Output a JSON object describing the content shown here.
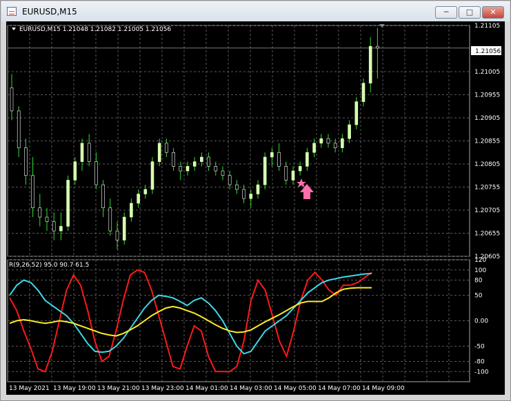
{
  "window": {
    "title": "EURUSD,M15",
    "buttons": {
      "minimize": "─",
      "maximize": "□",
      "close": "✕"
    }
  },
  "chart": {
    "header": "EURUSD,M15  1.21048 1.21082 1.21005 1.21056",
    "current_price_label": "1.21056",
    "current_price": 1.21056,
    "indicator_header": "R(9,26,52) 95.0 90.7 61.5",
    "colors": {
      "background": "#000000",
      "grid": "#5a5a5a",
      "bull_candle": "#d8ffb0",
      "bear_candle": "#000000",
      "wick": "#33dd33",
      "red_line": "#ff1a1a",
      "cyan_line": "#3fd8ec",
      "yellow_line": "#ffee22",
      "arrow": "#ff6fa8"
    },
    "signal_icons": [
      "star-icon",
      "up-arrow-icon"
    ]
  },
  "chart_data": [
    {
      "type": "candlestick",
      "title": "EURUSD,M15",
      "ylim": [
        1.20605,
        1.21105
      ],
      "y_ticks": [
        "1.21105",
        "1.21056",
        "1.21005",
        "1.20955",
        "1.20905",
        "1.20855",
        "1.20805",
        "1.20755",
        "1.20705",
        "1.20655",
        "1.20605"
      ],
      "x_ticks": [
        "13 May 2021",
        "13 May 19:00",
        "13 May 21:00",
        "13 May 23:00",
        "14 May 01:00",
        "14 May 03:00",
        "14 May 05:00",
        "14 May 07:00",
        "14 May 09:00"
      ],
      "candles": [
        [
          1.2097,
          1.21,
          1.209,
          1.2092
        ],
        [
          1.2092,
          1.2093,
          1.2082,
          1.2084
        ],
        [
          1.2084,
          1.2086,
          1.2076,
          1.2078
        ],
        [
          1.2078,
          1.2082,
          1.2069,
          1.2071
        ],
        [
          1.2071,
          1.2074,
          1.2067,
          1.2069
        ],
        [
          1.2069,
          1.2071,
          1.2066,
          1.2068
        ],
        [
          1.2068,
          1.207,
          1.2064,
          1.2066
        ],
        [
          1.2066,
          1.207,
          1.2064,
          1.2067
        ],
        [
          1.2067,
          1.2078,
          1.2066,
          1.2077
        ],
        [
          1.2077,
          1.2082,
          1.2076,
          1.2081
        ],
        [
          1.2081,
          1.2086,
          1.2079,
          1.2085
        ],
        [
          1.2085,
          1.2087,
          1.208,
          1.2081
        ],
        [
          1.2081,
          1.2083,
          1.2075,
          1.2076
        ],
        [
          1.2076,
          1.2077,
          1.2069,
          1.2071
        ],
        [
          1.2071,
          1.2073,
          1.2065,
          1.2066
        ],
        [
          1.2066,
          1.2068,
          1.2062,
          1.2064
        ],
        [
          1.2064,
          1.207,
          1.2063,
          1.2069
        ],
        [
          1.2069,
          1.2073,
          1.2068,
          1.2072
        ],
        [
          1.2072,
          1.2075,
          1.2071,
          1.2074
        ],
        [
          1.2074,
          1.2076,
          1.2073,
          1.2075
        ],
        [
          1.2075,
          1.2082,
          1.2074,
          1.2081
        ],
        [
          1.2081,
          1.2086,
          1.208,
          1.2085
        ],
        [
          1.2085,
          1.2086,
          1.2082,
          1.2083
        ],
        [
          1.2083,
          1.2084,
          1.2079,
          1.208
        ],
        [
          1.208,
          1.2081,
          1.2077,
          1.2079
        ],
        [
          1.2079,
          1.2081,
          1.2078,
          1.208
        ],
        [
          1.208,
          1.2082,
          1.2079,
          1.2081
        ],
        [
          1.2081,
          1.2083,
          1.208,
          1.2082
        ],
        [
          1.2082,
          1.2083,
          1.2079,
          1.208
        ],
        [
          1.208,
          1.2081,
          1.2078,
          1.2079
        ],
        [
          1.2079,
          1.208,
          1.2077,
          1.2078
        ],
        [
          1.2078,
          1.2079,
          1.2075,
          1.2076
        ],
        [
          1.2076,
          1.2077,
          1.2074,
          1.2075
        ],
        [
          1.2075,
          1.2076,
          1.2072,
          1.2073
        ],
        [
          1.2073,
          1.2075,
          1.2071,
          1.2074
        ],
        [
          1.2074,
          1.2077,
          1.2073,
          1.2076
        ],
        [
          1.2076,
          1.2083,
          1.2075,
          1.2082
        ],
        [
          1.2082,
          1.2084,
          1.208,
          1.2083
        ],
        [
          1.2083,
          1.2085,
          1.2079,
          1.208
        ],
        [
          1.208,
          1.2081,
          1.2076,
          1.2077
        ],
        [
          1.2077,
          1.208,
          1.2076,
          1.2079
        ],
        [
          1.2079,
          1.2081,
          1.2078,
          1.208
        ],
        [
          1.208,
          1.2084,
          1.2079,
          1.2083
        ],
        [
          1.2083,
          1.2086,
          1.2082,
          1.2085
        ],
        [
          1.2085,
          1.2087,
          1.2084,
          1.2086
        ],
        [
          1.2086,
          1.2087,
          1.2084,
          1.2085
        ],
        [
          1.2085,
          1.2086,
          1.2083,
          1.2084
        ],
        [
          1.2084,
          1.2087,
          1.2083,
          1.2086
        ],
        [
          1.2086,
          1.209,
          1.2085,
          1.2089
        ],
        [
          1.2089,
          1.2095,
          1.2088,
          1.2094
        ],
        [
          1.2094,
          1.2099,
          1.2093,
          1.2098
        ],
        [
          1.2098,
          1.2108,
          1.2096,
          1.2106
        ],
        [
          1.2106,
          1.211,
          1.2099,
          1.21056
        ]
      ]
    },
    {
      "type": "line",
      "title": "R(9,26,52) 95.0 90.7 61.5",
      "ylim": [
        -120,
        120
      ],
      "y_ticks": [
        "120",
        "100",
        "80",
        "50",
        "0.00",
        "-50",
        "-80",
        "-100"
      ],
      "series": [
        {
          "color": "#ff1a1a",
          "values": [
            45,
            20,
            -20,
            -55,
            -95,
            -100,
            -60,
            0,
            60,
            90,
            70,
            20,
            -40,
            -80,
            -70,
            -20,
            40,
            90,
            100,
            95,
            60,
            10,
            -40,
            -90,
            -95,
            -50,
            -10,
            -20,
            -70,
            -100,
            -100,
            -100,
            -90,
            -40,
            40,
            80,
            60,
            10,
            -40,
            -70,
            -20,
            40,
            80,
            95,
            80,
            60,
            50,
            70,
            70,
            75,
            85,
            95
          ]
        },
        {
          "color": "#3fd8ec",
          "values": [
            50,
            70,
            80,
            75,
            60,
            40,
            30,
            20,
            10,
            -5,
            -25,
            -45,
            -60,
            -62,
            -60,
            -50,
            -35,
            -15,
            5,
            25,
            40,
            50,
            48,
            45,
            38,
            30,
            40,
            45,
            35,
            20,
            0,
            -25,
            -50,
            -65,
            -60,
            -40,
            -20,
            -10,
            0,
            10,
            25,
            40,
            55,
            65,
            75,
            80,
            83,
            86,
            88,
            90,
            92,
            93
          ]
        },
        {
          "color": "#ffee22",
          "values": [
            -5,
            0,
            2,
            0,
            -3,
            -5,
            -3,
            0,
            -2,
            -5,
            -10,
            -15,
            -20,
            -25,
            -28,
            -30,
            -25,
            -18,
            -10,
            0,
            10,
            18,
            25,
            28,
            25,
            20,
            15,
            8,
            0,
            -8,
            -15,
            -20,
            -23,
            -22,
            -18,
            -10,
            -2,
            5,
            12,
            20,
            28,
            35,
            38,
            38,
            38,
            45,
            55,
            62,
            64,
            65,
            65,
            65
          ]
        }
      ]
    }
  ]
}
